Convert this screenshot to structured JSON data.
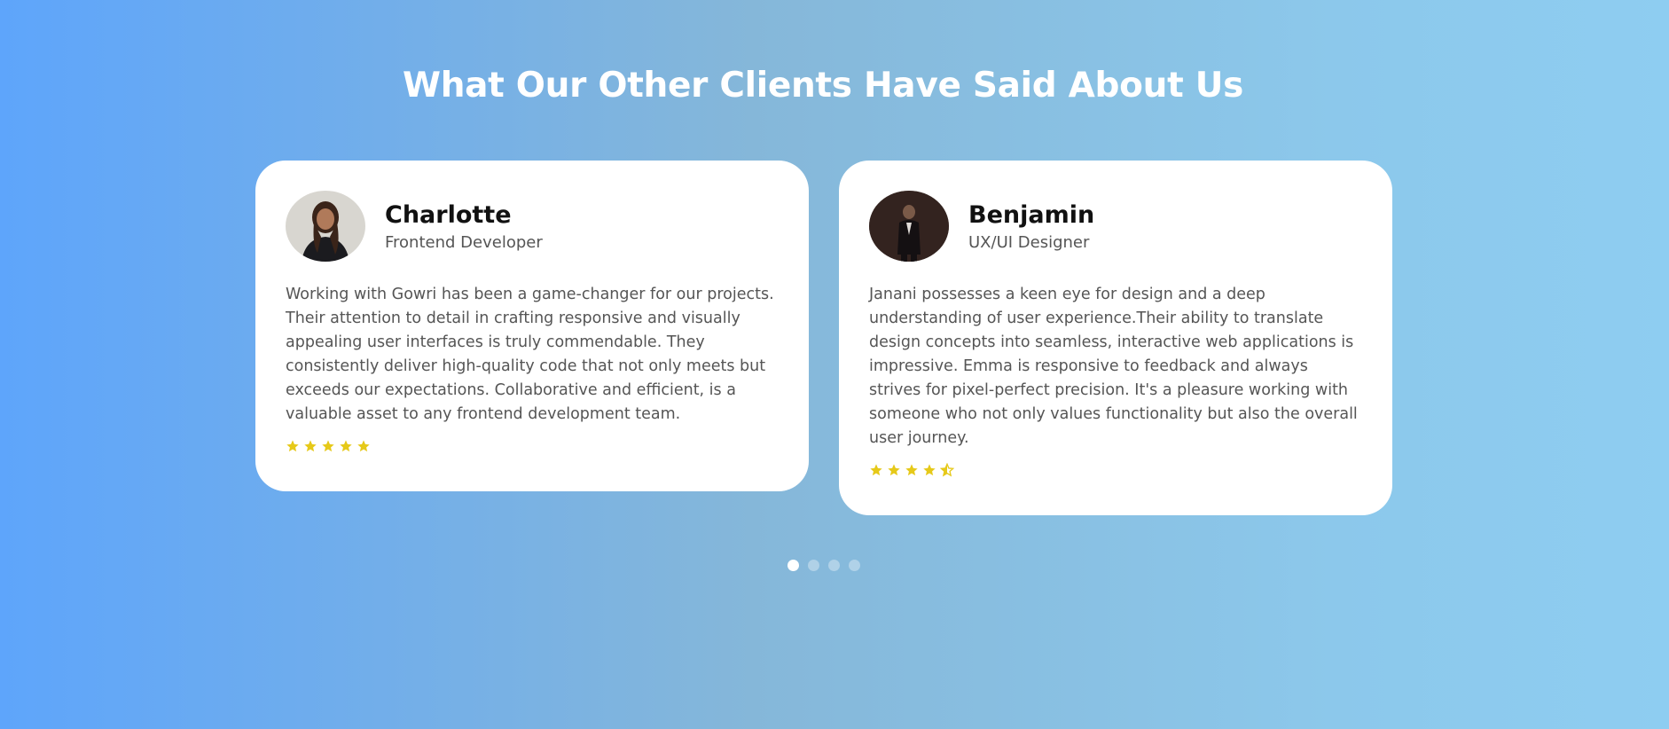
{
  "section": {
    "title": "What Our Other Clients Have Said About Us"
  },
  "testimonials": [
    {
      "name": "Charlotte",
      "role": "Frontend Developer",
      "quote": "Working with Gowri has been a game-changer for our projects. Their attention to detail in crafting responsive and visually appealing user interfaces is truly commendable. They consistently deliver high-quality code that not only meets but exceeds our expectations. Collaborative and efficient, is a valuable asset to any frontend development team.",
      "rating": 5
    },
    {
      "name": "Benjamin",
      "role": "UX/UI Designer",
      "quote": "Janani possesses a keen eye for design and a deep understanding of user experience.Their ability to translate design concepts into seamless, interactive web applications is impressive. Emma is responsive to feedback and always strives for pixel-perfect precision. It's a pleasure working with someone who not only values functionality but also the overall user journey.",
      "rating": 4.5
    }
  ],
  "carousel": {
    "total_pages": 4,
    "active_page": 1
  },
  "colors": {
    "star": "#e6c919",
    "title": "#ffffff",
    "card_bg": "#ffffff"
  }
}
